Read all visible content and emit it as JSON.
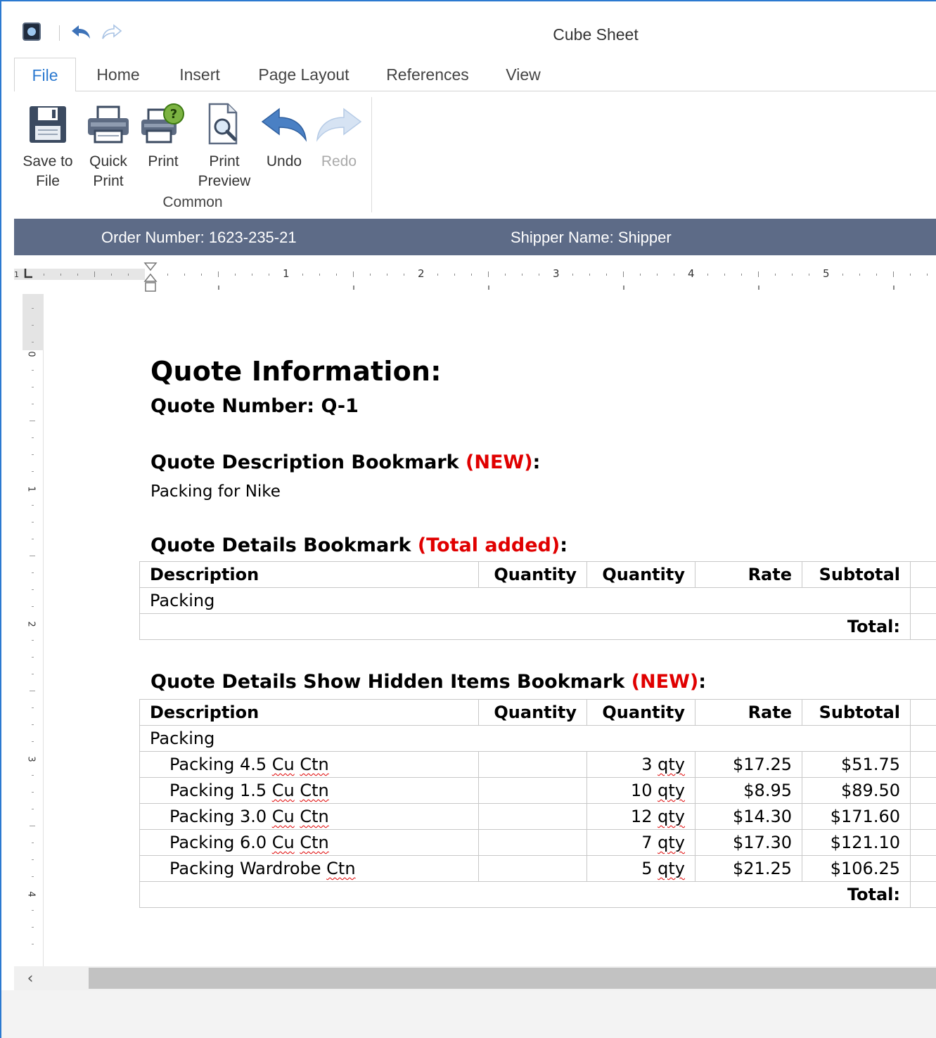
{
  "window": {
    "title": "Cube Sheet"
  },
  "tabs": [
    {
      "label": "File"
    },
    {
      "label": "Home"
    },
    {
      "label": "Insert"
    },
    {
      "label": "Page Layout"
    },
    {
      "label": "References"
    },
    {
      "label": "View"
    }
  ],
  "ribbon": {
    "buttons": [
      {
        "line1": "Save to",
        "line2": "File",
        "icon": "save-icon"
      },
      {
        "line1": "Quick",
        "line2": "Print",
        "icon": "quick-print-icon"
      },
      {
        "line1": "Print",
        "line2": "",
        "icon": "print-icon"
      },
      {
        "line1": "Print",
        "line2": "Preview",
        "icon": "print-preview-icon"
      },
      {
        "line1": "Undo",
        "line2": "",
        "icon": "undo-icon"
      },
      {
        "line1": "Redo",
        "line2": "",
        "icon": "redo-icon",
        "disabled": true
      }
    ],
    "group_label": "Common"
  },
  "band": {
    "order_number": "Order Number: 1623-235-21",
    "shipper_name": "Shipper Name: Shipper",
    "color": "#5d6b87"
  },
  "ruler": {
    "h_numbers": [
      "1",
      "2",
      "3",
      "4",
      "5"
    ],
    "v_numbers": [
      "0",
      "1",
      "2",
      "3",
      "4"
    ]
  },
  "document": {
    "title": "Quote Information:",
    "quote_number": "Quote Number: Q-1",
    "desc_heading": "Quote Description Bookmark ",
    "desc_heading_red": "(NEW)",
    "desc_heading_end": ":",
    "description": "Packing for Nike",
    "details_heading": "Quote Details Bookmark ",
    "details_heading_red": "(Total added)",
    "details_heading_end": ":",
    "table_headers": [
      "Description",
      "Quantity",
      "Quantity",
      "Rate",
      "Subtotal"
    ],
    "table1": {
      "group": "Packing",
      "total_label": "Total:"
    },
    "hidden_heading": "Quote Details Show Hidden Items Bookmark ",
    "hidden_heading_red": "(NEW)",
    "hidden_heading_end": ":",
    "table2": {
      "group": "Packing",
      "rows": [
        {
          "desc_a": "Packing 4.5 ",
          "desc_b": "Cu",
          "desc_c": " ",
          "desc_d": "Ctn",
          "qty_num": "3 ",
          "qty_unit": "qty",
          "rate": "$17.25",
          "subtotal": "$51.75"
        },
        {
          "desc_a": "Packing 1.5 ",
          "desc_b": "Cu",
          "desc_c": " ",
          "desc_d": "Ctn",
          "qty_num": "10 ",
          "qty_unit": "qty",
          "rate": "$8.95",
          "subtotal": "$89.50"
        },
        {
          "desc_a": "Packing 3.0 ",
          "desc_b": "Cu",
          "desc_c": " ",
          "desc_d": "Ctn",
          "qty_num": "12 ",
          "qty_unit": "qty",
          "rate": "$14.30",
          "subtotal": "$171.60"
        },
        {
          "desc_a": "Packing 6.0 ",
          "desc_b": "Cu",
          "desc_c": " ",
          "desc_d": "Ctn",
          "qty_num": "7 ",
          "qty_unit": "qty",
          "rate": "$17.30",
          "subtotal": "$121.10"
        },
        {
          "desc_a": "Packing Wardrobe ",
          "desc_b": "",
          "desc_c": "",
          "desc_d": "Ctn",
          "qty_num": "5 ",
          "qty_unit": "qty",
          "rate": "$21.25",
          "subtotal": "$106.25"
        }
      ],
      "total_label": "Total:"
    }
  },
  "scrollbar": {
    "left_arrow": "‹"
  },
  "colors": {
    "accent": "#2b79d0",
    "red": "#e00000"
  }
}
